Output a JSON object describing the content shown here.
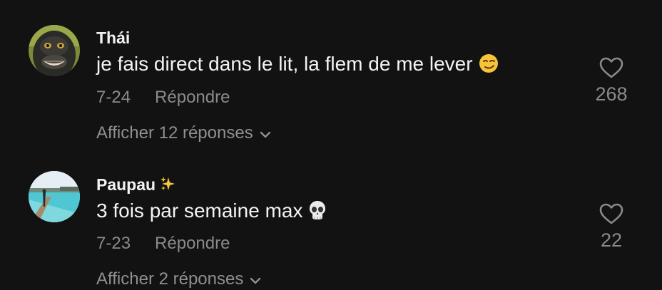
{
  "comments": [
    {
      "username": "Thái",
      "text": "je fais direct dans le lit, la flem de me lever",
      "emoji": "smirking-face-emoji",
      "date": "7-24",
      "reply_label": "Répondre",
      "likes": "268",
      "view_replies": "Afficher 12 réponses"
    },
    {
      "username": "Paupau",
      "username_badge": "sparkles-emoji",
      "text": "3 fois par semaine max",
      "emoji": "skull-emoji",
      "date": "7-23",
      "reply_label": "Répondre",
      "likes": "22",
      "view_replies": "Afficher 2 réponses"
    }
  ],
  "colors": {
    "background": "#121212",
    "primary_text": "#f4f4f4",
    "secondary_text": "#8a8a8a"
  }
}
